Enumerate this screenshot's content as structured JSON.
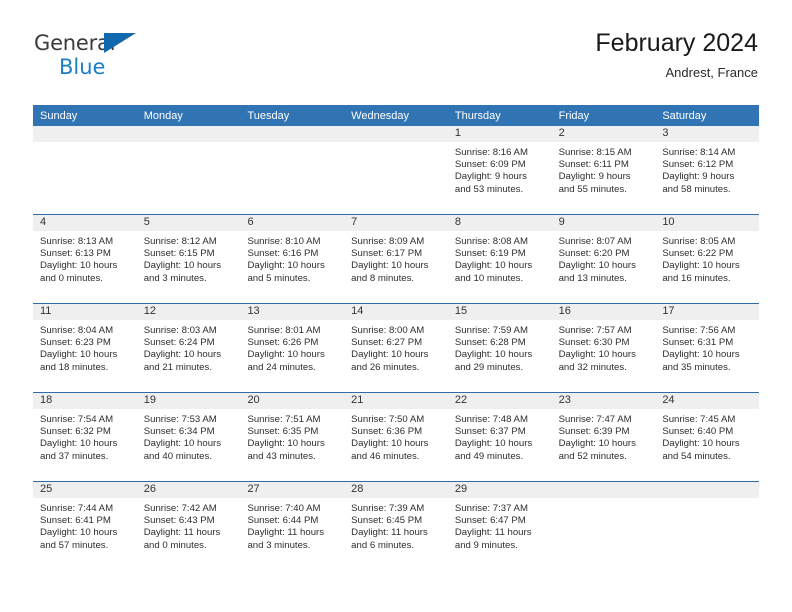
{
  "brand": {
    "name_part1": "General",
    "name_part2": "Blue",
    "accent_color": "#1b7fc4"
  },
  "header": {
    "title": "February 2024",
    "location": "Andrest, France",
    "header_bg": "#3174b4"
  },
  "weekday_headers": [
    "Sunday",
    "Monday",
    "Tuesday",
    "Wednesday",
    "Thursday",
    "Friday",
    "Saturday"
  ],
  "weeks": [
    [
      {
        "day": "",
        "blank": true
      },
      {
        "day": "",
        "blank": true
      },
      {
        "day": "",
        "blank": true
      },
      {
        "day": "",
        "blank": true
      },
      {
        "day": "1",
        "sunrise": "Sunrise: 8:16 AM",
        "sunset": "Sunset: 6:09 PM",
        "daylight1": "Daylight: 9 hours",
        "daylight2": "and 53 minutes."
      },
      {
        "day": "2",
        "sunrise": "Sunrise: 8:15 AM",
        "sunset": "Sunset: 6:11 PM",
        "daylight1": "Daylight: 9 hours",
        "daylight2": "and 55 minutes."
      },
      {
        "day": "3",
        "sunrise": "Sunrise: 8:14 AM",
        "sunset": "Sunset: 6:12 PM",
        "daylight1": "Daylight: 9 hours",
        "daylight2": "and 58 minutes."
      }
    ],
    [
      {
        "day": "4",
        "sunrise": "Sunrise: 8:13 AM",
        "sunset": "Sunset: 6:13 PM",
        "daylight1": "Daylight: 10 hours",
        "daylight2": "and 0 minutes."
      },
      {
        "day": "5",
        "sunrise": "Sunrise: 8:12 AM",
        "sunset": "Sunset: 6:15 PM",
        "daylight1": "Daylight: 10 hours",
        "daylight2": "and 3 minutes."
      },
      {
        "day": "6",
        "sunrise": "Sunrise: 8:10 AM",
        "sunset": "Sunset: 6:16 PM",
        "daylight1": "Daylight: 10 hours",
        "daylight2": "and 5 minutes."
      },
      {
        "day": "7",
        "sunrise": "Sunrise: 8:09 AM",
        "sunset": "Sunset: 6:17 PM",
        "daylight1": "Daylight: 10 hours",
        "daylight2": "and 8 minutes."
      },
      {
        "day": "8",
        "sunrise": "Sunrise: 8:08 AM",
        "sunset": "Sunset: 6:19 PM",
        "daylight1": "Daylight: 10 hours",
        "daylight2": "and 10 minutes."
      },
      {
        "day": "9",
        "sunrise": "Sunrise: 8:07 AM",
        "sunset": "Sunset: 6:20 PM",
        "daylight1": "Daylight: 10 hours",
        "daylight2": "and 13 minutes."
      },
      {
        "day": "10",
        "sunrise": "Sunrise: 8:05 AM",
        "sunset": "Sunset: 6:22 PM",
        "daylight1": "Daylight: 10 hours",
        "daylight2": "and 16 minutes."
      }
    ],
    [
      {
        "day": "11",
        "sunrise": "Sunrise: 8:04 AM",
        "sunset": "Sunset: 6:23 PM",
        "daylight1": "Daylight: 10 hours",
        "daylight2": "and 18 minutes."
      },
      {
        "day": "12",
        "sunrise": "Sunrise: 8:03 AM",
        "sunset": "Sunset: 6:24 PM",
        "daylight1": "Daylight: 10 hours",
        "daylight2": "and 21 minutes."
      },
      {
        "day": "13",
        "sunrise": "Sunrise: 8:01 AM",
        "sunset": "Sunset: 6:26 PM",
        "daylight1": "Daylight: 10 hours",
        "daylight2": "and 24 minutes."
      },
      {
        "day": "14",
        "sunrise": "Sunrise: 8:00 AM",
        "sunset": "Sunset: 6:27 PM",
        "daylight1": "Daylight: 10 hours",
        "daylight2": "and 26 minutes."
      },
      {
        "day": "15",
        "sunrise": "Sunrise: 7:59 AM",
        "sunset": "Sunset: 6:28 PM",
        "daylight1": "Daylight: 10 hours",
        "daylight2": "and 29 minutes."
      },
      {
        "day": "16",
        "sunrise": "Sunrise: 7:57 AM",
        "sunset": "Sunset: 6:30 PM",
        "daylight1": "Daylight: 10 hours",
        "daylight2": "and 32 minutes."
      },
      {
        "day": "17",
        "sunrise": "Sunrise: 7:56 AM",
        "sunset": "Sunset: 6:31 PM",
        "daylight1": "Daylight: 10 hours",
        "daylight2": "and 35 minutes."
      }
    ],
    [
      {
        "day": "18",
        "sunrise": "Sunrise: 7:54 AM",
        "sunset": "Sunset: 6:32 PM",
        "daylight1": "Daylight: 10 hours",
        "daylight2": "and 37 minutes."
      },
      {
        "day": "19",
        "sunrise": "Sunrise: 7:53 AM",
        "sunset": "Sunset: 6:34 PM",
        "daylight1": "Daylight: 10 hours",
        "daylight2": "and 40 minutes."
      },
      {
        "day": "20",
        "sunrise": "Sunrise: 7:51 AM",
        "sunset": "Sunset: 6:35 PM",
        "daylight1": "Daylight: 10 hours",
        "daylight2": "and 43 minutes."
      },
      {
        "day": "21",
        "sunrise": "Sunrise: 7:50 AM",
        "sunset": "Sunset: 6:36 PM",
        "daylight1": "Daylight: 10 hours",
        "daylight2": "and 46 minutes."
      },
      {
        "day": "22",
        "sunrise": "Sunrise: 7:48 AM",
        "sunset": "Sunset: 6:37 PM",
        "daylight1": "Daylight: 10 hours",
        "daylight2": "and 49 minutes."
      },
      {
        "day": "23",
        "sunrise": "Sunrise: 7:47 AM",
        "sunset": "Sunset: 6:39 PM",
        "daylight1": "Daylight: 10 hours",
        "daylight2": "and 52 minutes."
      },
      {
        "day": "24",
        "sunrise": "Sunrise: 7:45 AM",
        "sunset": "Sunset: 6:40 PM",
        "daylight1": "Daylight: 10 hours",
        "daylight2": "and 54 minutes."
      }
    ],
    [
      {
        "day": "25",
        "sunrise": "Sunrise: 7:44 AM",
        "sunset": "Sunset: 6:41 PM",
        "daylight1": "Daylight: 10 hours",
        "daylight2": "and 57 minutes."
      },
      {
        "day": "26",
        "sunrise": "Sunrise: 7:42 AM",
        "sunset": "Sunset: 6:43 PM",
        "daylight1": "Daylight: 11 hours",
        "daylight2": "and 0 minutes."
      },
      {
        "day": "27",
        "sunrise": "Sunrise: 7:40 AM",
        "sunset": "Sunset: 6:44 PM",
        "daylight1": "Daylight: 11 hours",
        "daylight2": "and 3 minutes."
      },
      {
        "day": "28",
        "sunrise": "Sunrise: 7:39 AM",
        "sunset": "Sunset: 6:45 PM",
        "daylight1": "Daylight: 11 hours",
        "daylight2": "and 6 minutes."
      },
      {
        "day": "29",
        "sunrise": "Sunrise: 7:37 AM",
        "sunset": "Sunset: 6:47 PM",
        "daylight1": "Daylight: 11 hours",
        "daylight2": "and 9 minutes."
      },
      {
        "day": "",
        "blank": true
      },
      {
        "day": "",
        "blank": true
      }
    ]
  ]
}
